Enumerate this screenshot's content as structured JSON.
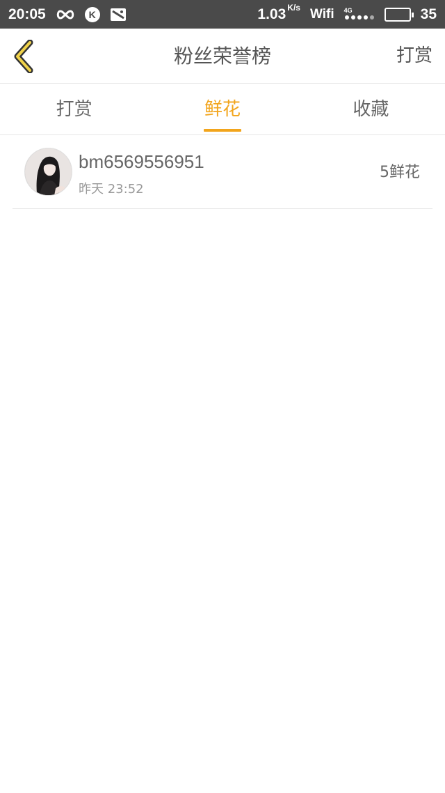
{
  "status_bar": {
    "time": "20:05",
    "speed": "1.03",
    "speed_unit": "K/s",
    "wifi_label": "Wifi",
    "network": "4G",
    "battery_level": "35"
  },
  "header": {
    "title": "粉丝荣誉榜",
    "action_label": "打赏",
    "accent_color": "#f2a51c"
  },
  "tabs": [
    {
      "label": "打赏",
      "active": false
    },
    {
      "label": "鲜花",
      "active": true
    },
    {
      "label": "收藏",
      "active": false
    }
  ],
  "list": [
    {
      "username": "bm6569556951",
      "time": "昨天 23:52",
      "amount": "5鲜花",
      "avatar_icon": "user-avatar"
    }
  ]
}
